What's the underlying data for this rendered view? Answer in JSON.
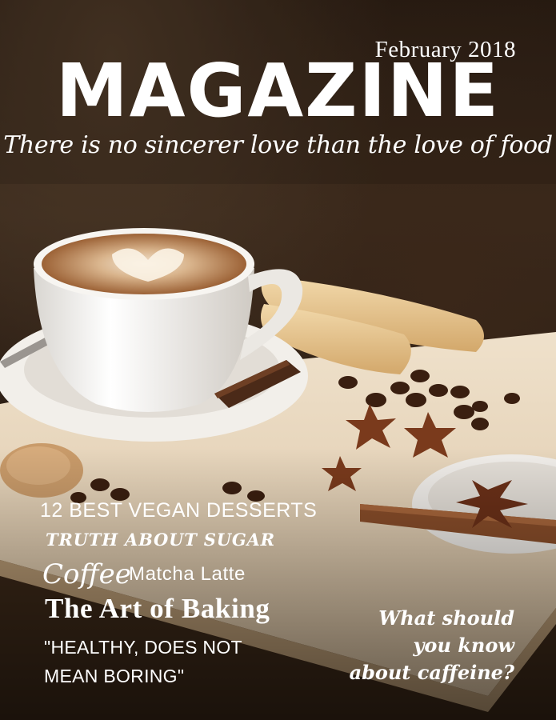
{
  "cover": {
    "date": "February 2018",
    "title": "MAGAZINE",
    "tagline": "There is no sincerer love than the love of food"
  },
  "headlines": {
    "vegan": "12 BEST VEGAN DESSERTS",
    "sugar": "TRUTH ABOUT SUGAR",
    "coffee": "Coffee",
    "matcha": "Matcha Latte",
    "baking": "The Art of Baking",
    "healthy": "\"HEALTHY, DOES NOT\nMEAN BORING\""
  },
  "sidebar": {
    "question": "What should\nyou know\nabout caffeine?"
  },
  "image": {
    "subject": "cup of latte with heart latte art on saucer, ladyfinger biscuits, coffee beans, star anise, cinnamon sticks and chocolate on a wooden board"
  },
  "colors": {
    "text": "#ffffff",
    "board": "#e8d6bd",
    "cup": "#f4f2ee",
    "coffee": "#b07a4a"
  }
}
